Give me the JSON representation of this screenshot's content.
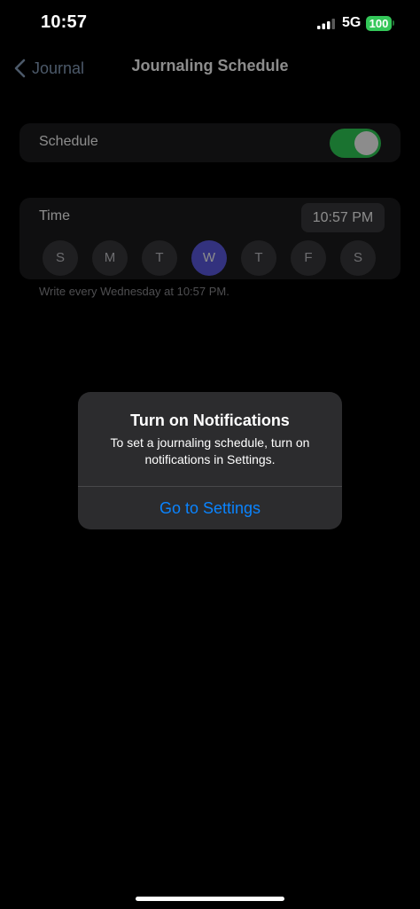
{
  "status_bar": {
    "time": "10:57",
    "network": "5G",
    "battery": "100",
    "signal_icon": "signal-bars-icon",
    "battery_color": "#34c759"
  },
  "nav": {
    "back_label": "Journal",
    "back_icon": "chevron-left-icon",
    "title": "Journaling Schedule"
  },
  "schedule": {
    "label": "Schedule",
    "enabled": true,
    "toggle_color": "#30d158"
  },
  "time": {
    "label": "Time",
    "value": "10:57 PM"
  },
  "days": [
    {
      "label": "S",
      "selected": false
    },
    {
      "label": "M",
      "selected": false
    },
    {
      "label": "T",
      "selected": false
    },
    {
      "label": "W",
      "selected": true
    },
    {
      "label": "T",
      "selected": false
    },
    {
      "label": "F",
      "selected": false
    },
    {
      "label": "S",
      "selected": false
    }
  ],
  "note": "Write every Wednesday at 10:57 PM.",
  "alert": {
    "title": "Turn on Notifications",
    "message": "To set a journaling schedule, turn on notifications in Settings.",
    "button_label": "Go to Settings",
    "button_color": "#0a84ff"
  },
  "colors": {
    "accent": "#5e5ce6",
    "link": "#0a84ff",
    "background": "#000000",
    "card": "#1c1c1e"
  }
}
